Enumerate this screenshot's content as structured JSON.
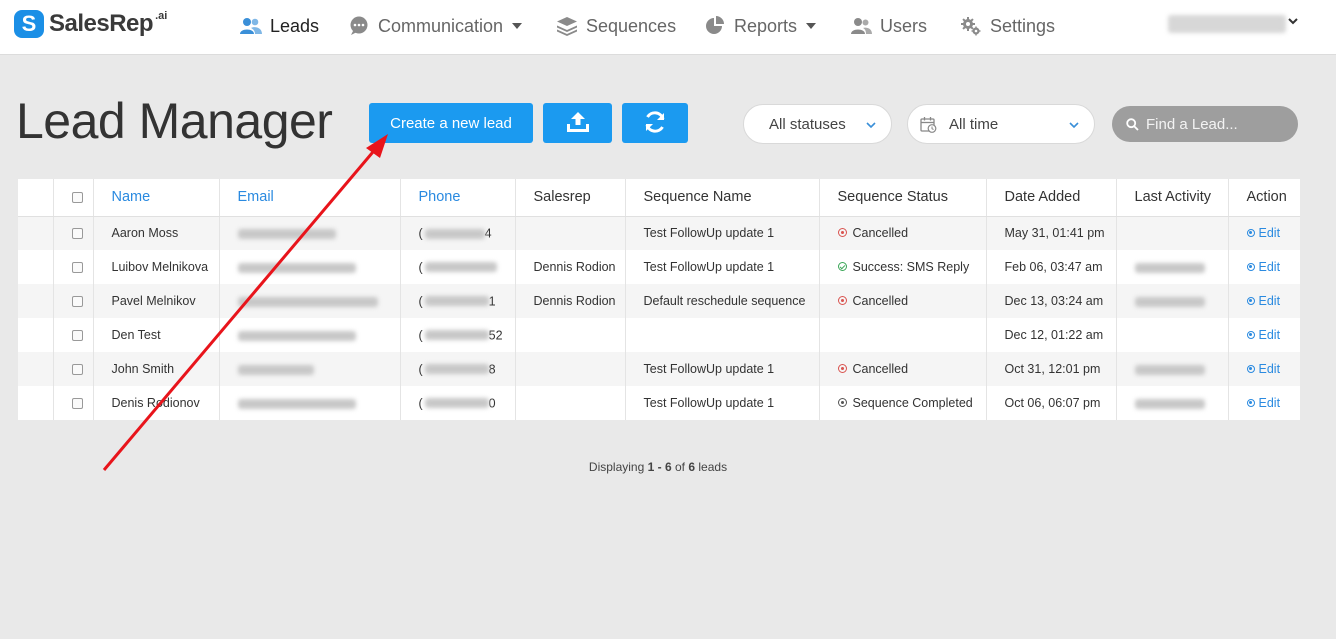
{
  "brand": {
    "mark": "S",
    "name": "SalesRep",
    "sup": ".ai"
  },
  "nav": {
    "items": [
      {
        "label": "Leads",
        "icon": "users-icon",
        "active": true
      },
      {
        "label": "Communication",
        "icon": "chat-icon",
        "dropdown": true
      },
      {
        "label": "Sequences",
        "icon": "layers-icon"
      },
      {
        "label": "Reports",
        "icon": "pie-chart-icon",
        "dropdown": true
      },
      {
        "label": "Users",
        "icon": "user-group-icon"
      },
      {
        "label": "Settings",
        "icon": "gear-icon"
      }
    ]
  },
  "page": {
    "title": "Lead Manager"
  },
  "toolbar": {
    "create_label": "Create a new lead",
    "upload_icon": "upload-icon",
    "refresh_icon": "refresh-icon"
  },
  "filters": {
    "status": "All statuses",
    "time": "All time",
    "search_placeholder": "Find a Lead..."
  },
  "table": {
    "columns": [
      "Name",
      "Email",
      "Phone",
      "Salesrep",
      "Sequence Name",
      "Sequence Status",
      "Date Added",
      "Last Activity",
      "Action"
    ],
    "rows": [
      {
        "name": "Aaron Moss",
        "phone_end": "4",
        "salesrep": "",
        "sequence": "Test FollowUp update 1",
        "status": "Cancelled",
        "status_type": "cancel",
        "date": "May 31, 01:41 pm",
        "action": "Edit"
      },
      {
        "name": "Luibov Melnikova",
        "phone_end": "",
        "salesrep": "Dennis Rodion",
        "sequence": "Test FollowUp update 1",
        "status": "Success: SMS Reply",
        "status_type": "success",
        "date": "Feb 06, 03:47 am",
        "action": "Edit"
      },
      {
        "name": "Pavel Melnikov",
        "phone_end": "1",
        "salesrep": "Dennis Rodion",
        "sequence": "Default reschedule sequence",
        "status": "Cancelled",
        "status_type": "cancel",
        "date": "Dec 13, 03:24 am",
        "action": "Edit"
      },
      {
        "name": "Den Test",
        "phone_end": "52",
        "salesrep": "",
        "sequence": "",
        "status": "",
        "status_type": "",
        "date": "Dec 12, 01:22 am",
        "action": "Edit"
      },
      {
        "name": "John Smith",
        "phone_end": "8",
        "salesrep": "",
        "sequence": "Test FollowUp update 1",
        "status": "Cancelled",
        "status_type": "cancel",
        "date": "Oct 31, 12:01 pm",
        "action": "Edit"
      },
      {
        "name": "Denis Rodionov",
        "phone_end": "0",
        "salesrep": "",
        "sequence": "Test FollowUp update 1",
        "status": "Sequence Completed",
        "status_type": "complete",
        "date": "Oct 06, 06:07 pm",
        "action": "Edit"
      }
    ]
  },
  "pagination": {
    "prefix": "Displaying",
    "range": "1 - 6",
    "middle": "of",
    "total": "6",
    "suffix": "leads"
  },
  "colors": {
    "accent": "#1b9af0",
    "link": "#2a8ae0",
    "annotation_arrow": "#e8141b"
  }
}
